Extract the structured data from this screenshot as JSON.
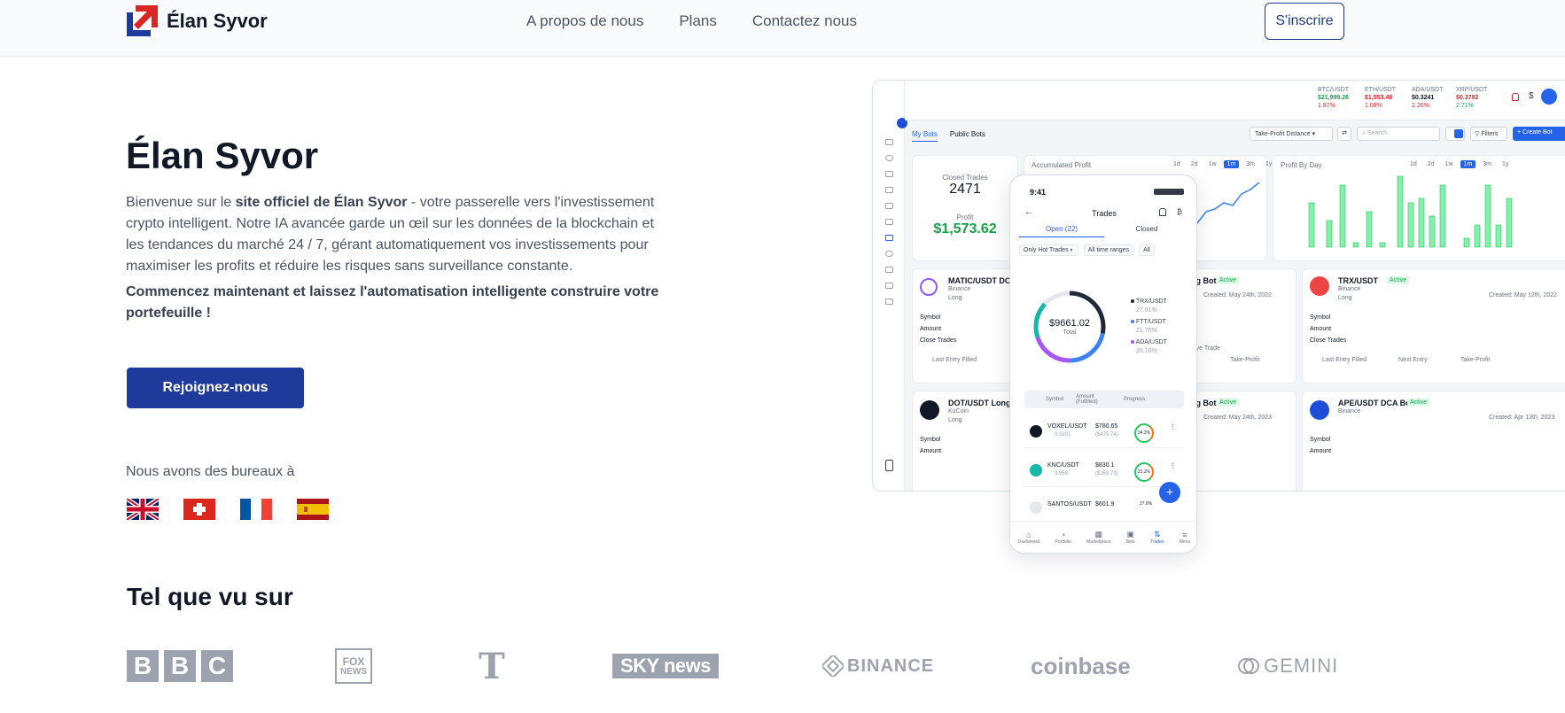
{
  "nav": {
    "brand": "Élan Syvor",
    "links": [
      "A propos de nous",
      "Plans",
      "Contactez nous"
    ],
    "signup": "S'inscrire"
  },
  "hero": {
    "title": "Élan Syvor",
    "p_prefix": "Bienvenue sur le ",
    "p_bold": "site officiel de Élan Syvor",
    "p_rest": " - votre passerelle vers l'investissement crypto intelligent. Notre IA avancée garde un œil sur les données de la blockchain et les tendances du marché 24 / 7, gérant automatiquement vos investissements pour maximiser les profits et réduire les risques sans surveillance constante.",
    "cta_text": "Commencez maintenant et laissez l'automatisation intelligente construire votre portefeuille !",
    "join_button": "Rejoignez-nous",
    "offices_label": "Nous avons des bureaux à"
  },
  "press": {
    "title": "Tel que vu sur",
    "logos": [
      "BBC",
      "FOX NEWS",
      "T",
      "SKY news",
      "BINANCE",
      "coinbase",
      "GEMINI"
    ]
  },
  "dashboard": {
    "tickers": [
      {
        "pair": "BTC/USDT",
        "price": "$21,999.26",
        "change": "1.87%"
      },
      {
        "pair": "ETH/USDT",
        "price": "$1,553.48",
        "change": "1.08%"
      },
      {
        "pair": "ADA/USDT",
        "price": "$0.3241",
        "change": "2.26%"
      },
      {
        "pair": "XRP/USDT",
        "price": "$0.3792",
        "change": "2.71%"
      }
    ],
    "tabs": [
      "My Bots",
      "Public Bots"
    ],
    "sort_select": "Take-Profit Distance",
    "search_placeholder": "Search",
    "filters": "Filters",
    "create": "+ Create Bot",
    "closed_trades_label": "Closed Trades",
    "closed_trades_value": "2471",
    "profit_label": "Profit",
    "profit_value": "$1,573.62",
    "accumulated_label": "Accumulated Profit",
    "profit_by_day_label": "Profit By Day",
    "ranges": [
      "1d",
      "2d",
      "1w",
      "1m",
      "3m",
      "1y"
    ],
    "bots": [
      {
        "name": "MATIC/USDT DCA",
        "exchange": "Binance",
        "side": "Long"
      },
      {
        "name": "USDT Long Bot",
        "status": "Active",
        "created": "Created: May 24th, 2022"
      },
      {
        "name": "TRX/USDT",
        "status": "Active",
        "exchange": "Binance",
        "side": "Long",
        "created": "Created: May 12th, 2022"
      },
      {
        "name": "DOT/USDT Long",
        "exchange": "KuCoin",
        "side": "Long"
      },
      {
        "name": "USDT Long Bot",
        "status": "Active",
        "created": "Created: May 24th, 2023"
      },
      {
        "name": "APE/USDT DCA Bot",
        "status": "Active",
        "exchange": "Binance",
        "side": "Long",
        "created": "Created: Apr 13th, 2023"
      }
    ],
    "row_labels": [
      "Symbol",
      "Amount",
      "Close Trades"
    ],
    "stats": {
      "last_entry": "Last Entry Filled",
      "next_entry": "Next Entry",
      "take_profit": "Take-Profit",
      "active_trade": "Active Trade"
    }
  },
  "phone": {
    "time": "9:41",
    "title": "Trades",
    "tabs": [
      "Open (22)",
      "Closed"
    ],
    "hot_trades": "Only Hot Trades",
    "time_ranges": "All time ranges",
    "all": "All",
    "total_value": "$9661.02",
    "total_label": "Total",
    "legend": [
      {
        "pair": "TRX/USDT",
        "pct": "27.91%",
        "color": "#1f2937"
      },
      {
        "pair": "FTT/USDT",
        "pct": "21.75%",
        "color": "#3b82f6"
      },
      {
        "pair": "ADA/USDT",
        "pct": "20.16%",
        "color": "#a855f7"
      }
    ],
    "col_symbol": "Symbol",
    "col_amount": "Amount (Fulfilled)",
    "col_progress": "Progress",
    "trades": [
      {
        "pair": "VOXEL/USDT",
        "sub": "0.3201",
        "amount": "$780.65",
        "sub_amount": "($475.74)",
        "pct": "34.2%"
      },
      {
        "pair": "KNC/USDT",
        "sub": "3.958",
        "amount": "$830.1",
        "sub_amount": "($353.79)",
        "pct": "23.2%"
      },
      {
        "pair": "SANTOS/USDT",
        "sub": "",
        "amount": "$601.9",
        "sub_amount": "",
        "pct": "27.8%"
      }
    ],
    "bottom_nav": [
      "Dashboard",
      "Portfolio",
      "Marketplace",
      "Bots",
      "Trades",
      "Menu"
    ]
  }
}
